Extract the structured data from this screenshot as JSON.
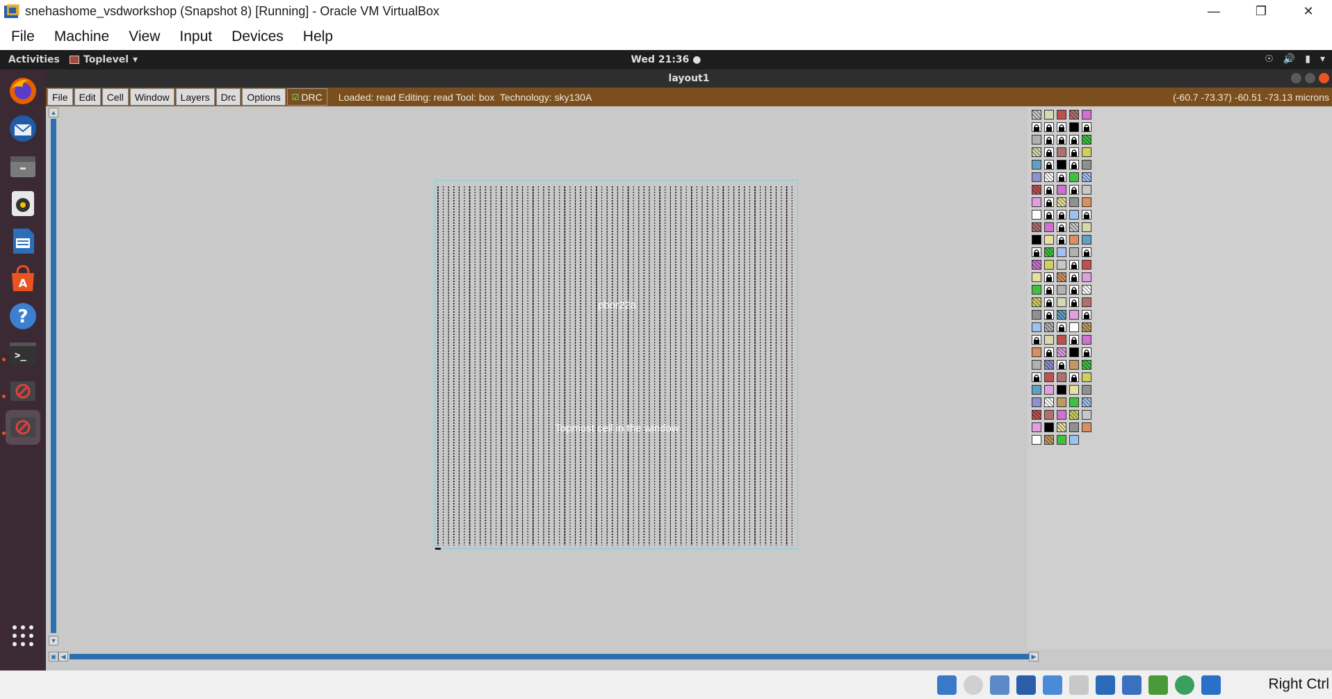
{
  "vbox": {
    "title": "snehashome_vsdworkshop (Snapshot 8) [Running] - Oracle VM VirtualBox",
    "menu": [
      "File",
      "Machine",
      "View",
      "Input",
      "Devices",
      "Help"
    ],
    "host_key": "Right Ctrl"
  },
  "gnome": {
    "activities": "Activities",
    "app_name": "Toplevel",
    "clock": "Wed 21:36"
  },
  "magic": {
    "window_title": "layout1",
    "menu": [
      "File",
      "Edit",
      "Cell",
      "Window",
      "Layers",
      "Drc",
      "Options"
    ],
    "drc_label": "DRC",
    "status": "Loaded: read Editing: read Tool: box  Technology: sky130A",
    "coords": "(-60.7 -73.37) -60.51 -73.13 microns",
    "cell_name": "pbor22a",
    "cell_desc": "Topmost cell in the window"
  },
  "dock_icons": [
    "firefox-icon",
    "thunderbird-icon",
    "files-icon",
    "rhythmbox-icon",
    "libreoffice-writer-icon",
    "software-center-icon",
    "help-icon",
    "terminal-icon",
    "magic-icon",
    "magic-active-icon",
    "app-grid-icon"
  ],
  "colors": {
    "magic_bar": "#7a4f1d",
    "canvas_bg": "#c9c9c9",
    "scroll_blue": "#2a6fb0",
    "dock_bg": "#3b2a34"
  }
}
